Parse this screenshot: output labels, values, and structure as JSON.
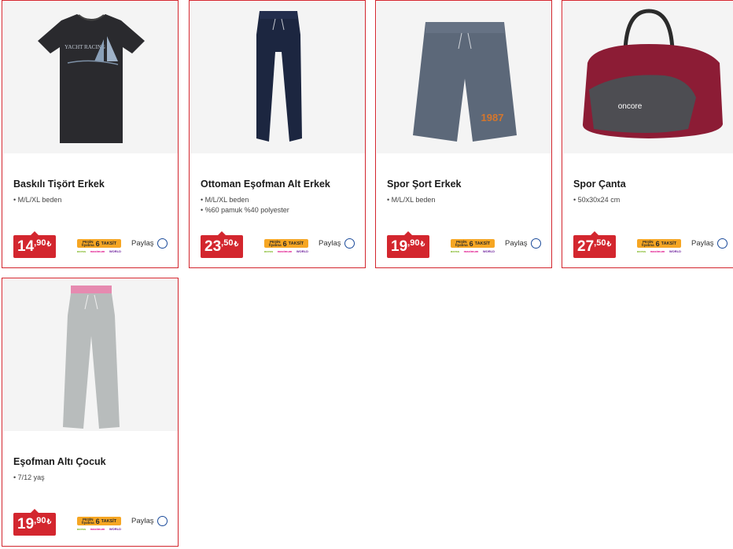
{
  "products": [
    {
      "title": "Baskılı Tişört Erkek",
      "features": [
        "M/L/XL beden"
      ],
      "price": {
        "main": "14",
        "cents": ",90",
        "currency": "₺"
      },
      "image": "black-tshirt",
      "image_text": "YACHT RACING"
    },
    {
      "title": "Ottoman Eşofman Alt Erkek",
      "features": [
        "M/L/XL beden",
        "%60 pamuk %40 polyester"
      ],
      "price": {
        "main": "23",
        "cents": ",50",
        "currency": "₺"
      },
      "image": "navy-sweatpants"
    },
    {
      "title": "Spor Şort Erkek",
      "features": [
        "M/L/XL beden"
      ],
      "price": {
        "main": "19",
        "cents": ",90",
        "currency": "₺"
      },
      "image": "grey-shorts",
      "image_text": "1987"
    },
    {
      "title": "Spor Çanta",
      "features": [
        "50x30x24 cm"
      ],
      "price": {
        "main": "27",
        "cents": ",50",
        "currency": "₺"
      },
      "image": "red-sports-bag",
      "image_text": "oncore"
    },
    {
      "title": "Eşofman Altı Çocuk",
      "features": [
        "7/12 yaş"
      ],
      "price": {
        "main": "19",
        "cents": ",90",
        "currency": "₺"
      },
      "image": "grey-kids-sweatpants"
    }
  ],
  "installment": {
    "pesin": "PEŞİN",
    "fiyatina": "fiyatına",
    "count": "6",
    "label": "TAKSİT",
    "cards": [
      "axess",
      "maximum",
      "WORLD"
    ]
  },
  "share_label": "Paylaş",
  "colors": {
    "accent": "#d3262e",
    "installment": "#f6a623",
    "share_circle": "#1a4a9a"
  }
}
